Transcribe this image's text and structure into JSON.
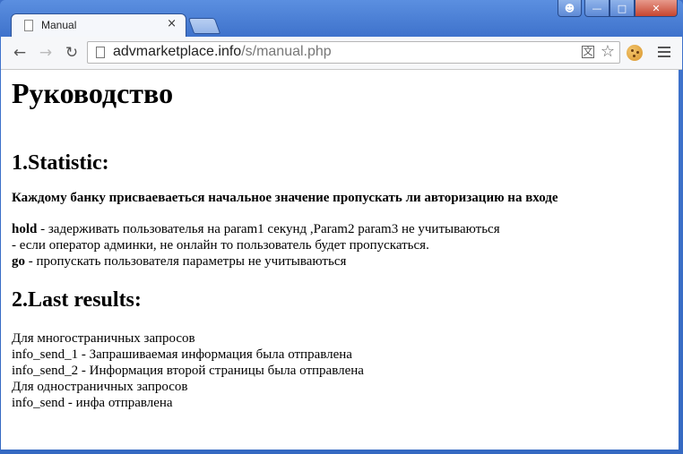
{
  "browser": {
    "tab_title": "Manual",
    "tab_close": "×",
    "url_host": "advmarketplace.info",
    "url_path": "/s/manual.php"
  },
  "page": {
    "heading": "Руководство",
    "section1_title": "1.Statistic:",
    "section1_intro": "Каждому банку присваеваеться начальное значение пропускать ли авторизацию на входе",
    "hold_key": "hold",
    "hold_text": " - задерживать пользователья на param1 секунд ,Param2 param3 не учитываються",
    "admin_line": "- если оператор админки, не онлайн то пользователь будет пропускаться.",
    "go_key": "go",
    "go_text": " - пропускать пользователя параметры не учитываються",
    "section2_title": "2.Last results:",
    "results": [
      "Для многостраничных запросов",
      "info_send_1 - Запрашиваемая информация была отправлена",
      "info_send_2 - Информация второй страницы была отправлена",
      "Для одностраничных запросов",
      "info_send - инфа отправлена"
    ]
  }
}
